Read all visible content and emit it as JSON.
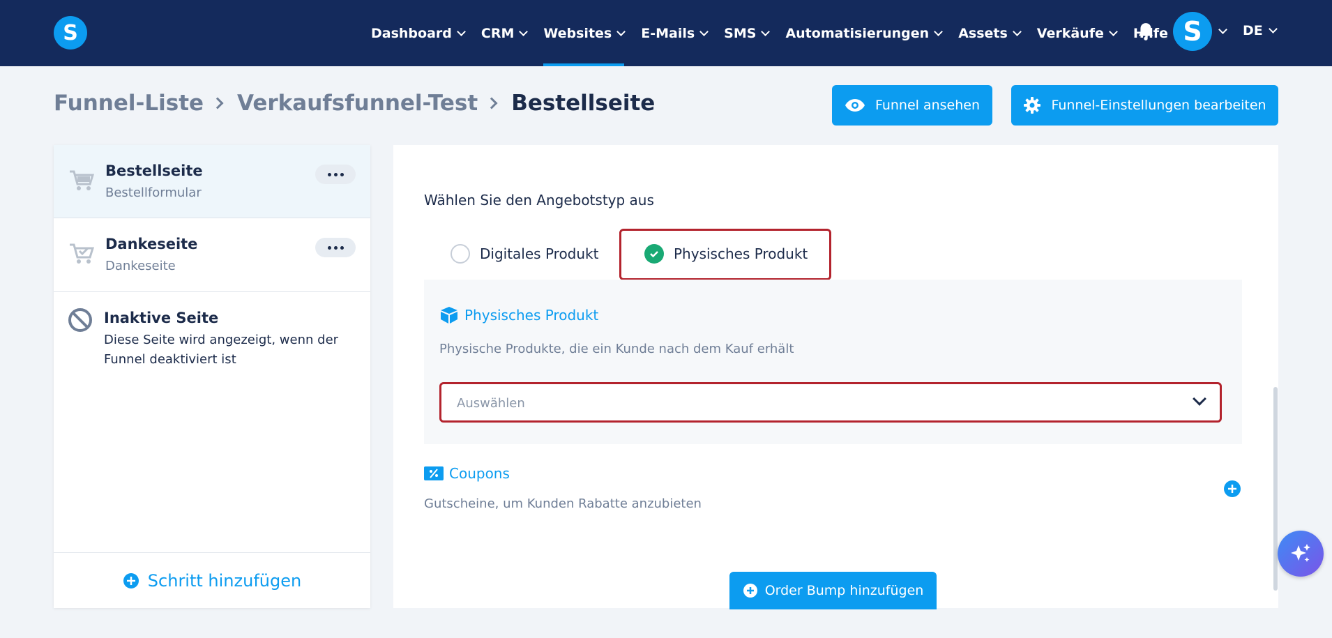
{
  "navbar": {
    "logo_letter": "S",
    "items": [
      {
        "label": "Dashboard"
      },
      {
        "label": "CRM"
      },
      {
        "label": "Websites"
      },
      {
        "label": "E-Mails"
      },
      {
        "label": "SMS"
      },
      {
        "label": "Automatisierungen"
      },
      {
        "label": "Assets"
      },
      {
        "label": "Verkäufe"
      }
    ],
    "active_item": "Websites",
    "help_label": "Hilfe",
    "avatar_letter": "S",
    "language": "DE"
  },
  "breadcrumb": {
    "items": [
      "Funnel-Liste",
      "Verkaufsfunnel-Test"
    ],
    "current": "Bestellseite"
  },
  "header_actions": {
    "view_funnel": "Funnel ansehen",
    "edit_settings": "Funnel-Einstellungen bearbeiten"
  },
  "sidebar": {
    "steps": [
      {
        "title": "Bestellseite",
        "subtitle": "Bestellformular",
        "icon": "cart-icon"
      },
      {
        "title": "Dankeseite",
        "subtitle": "Dankeseite",
        "icon": "cart-check-icon"
      }
    ],
    "inactive": {
      "title": "Inaktive Seite",
      "description": "Diese Seite wird angezeigt, wenn der Funnel deaktiviert ist"
    },
    "add_step": "Schritt hinzufügen"
  },
  "offer": {
    "label": "Wählen Sie den Angebotstyp aus",
    "options": [
      "Digitales Produkt",
      "Physisches Produkt"
    ],
    "selected": "Physisches Produkt"
  },
  "product_section": {
    "title": "Physisches Produkt",
    "description": "Physische Produkte, die ein Kunde nach dem Kauf erhält",
    "select_placeholder": "Auswählen"
  },
  "coupons": {
    "title": "Coupons",
    "description": "Gutscheine, um Kunden Rabatte anzubieten"
  },
  "order_bump": "Order Bump hinzufügen",
  "colors": {
    "navbar": "#142a5c",
    "accent": "#0c9cf0",
    "highlight": "#b3232d",
    "success": "#19a974"
  }
}
